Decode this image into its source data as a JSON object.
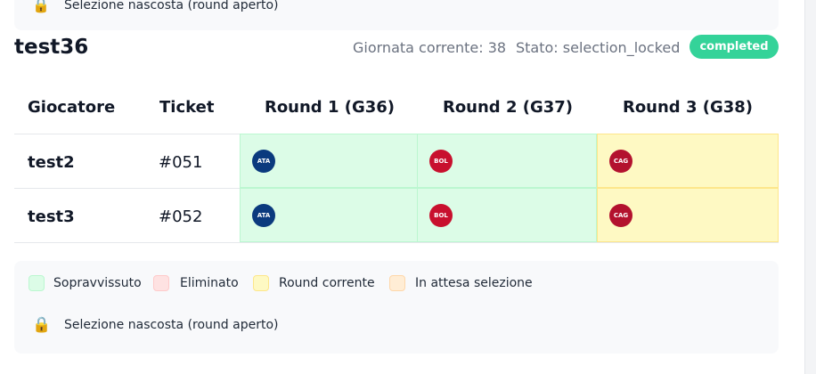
{
  "top_legend": {
    "lock_icon": "🔒",
    "locked_label": "Selezione nascosta (round aperto)"
  },
  "header": {
    "title": "test36",
    "giornata_label": "Giornata corrente: 38",
    "stato_label": "Stato: selection_locked",
    "status_badge": "completed"
  },
  "table": {
    "columns": [
      "Giocatore",
      "Ticket",
      "Round 1 (G36)",
      "Round 2 (G37)",
      "Round 3 (G38)"
    ],
    "rows": [
      {
        "player": "test2",
        "ticket": "#051",
        "picks": [
          {
            "team": "ATA",
            "color": "#0b3a7e",
            "status": "sopravvissuto"
          },
          {
            "team": "BOL",
            "color": "#c8102e",
            "status": "sopravvissuto"
          },
          {
            "team": "CAG",
            "color": "#b3122e",
            "status": "round-corrente"
          }
        ]
      },
      {
        "player": "test3",
        "ticket": "#052",
        "picks": [
          {
            "team": "ATA",
            "color": "#0b3a7e",
            "status": "sopravvissuto"
          },
          {
            "team": "BOL",
            "color": "#c8102e",
            "status": "sopravvissuto"
          },
          {
            "team": "CAG",
            "color": "#b3122e",
            "status": "round-corrente"
          }
        ]
      }
    ]
  },
  "legend": {
    "items": [
      {
        "label": "Sopravvissuto",
        "color": "#dcfce7"
      },
      {
        "label": "Eliminato",
        "color": "#fee2e2"
      },
      {
        "label": "Round corrente",
        "color": "#fef9c3"
      },
      {
        "label": "In attesa selezione",
        "color": "#ffedd5"
      }
    ],
    "lock_icon": "🔒",
    "locked_label": "Selezione nascosta (round aperto)"
  },
  "colors": {
    "badge": "#34d399",
    "accent_green": "#dcfce7",
    "accent_yellow": "#fef9c3"
  }
}
